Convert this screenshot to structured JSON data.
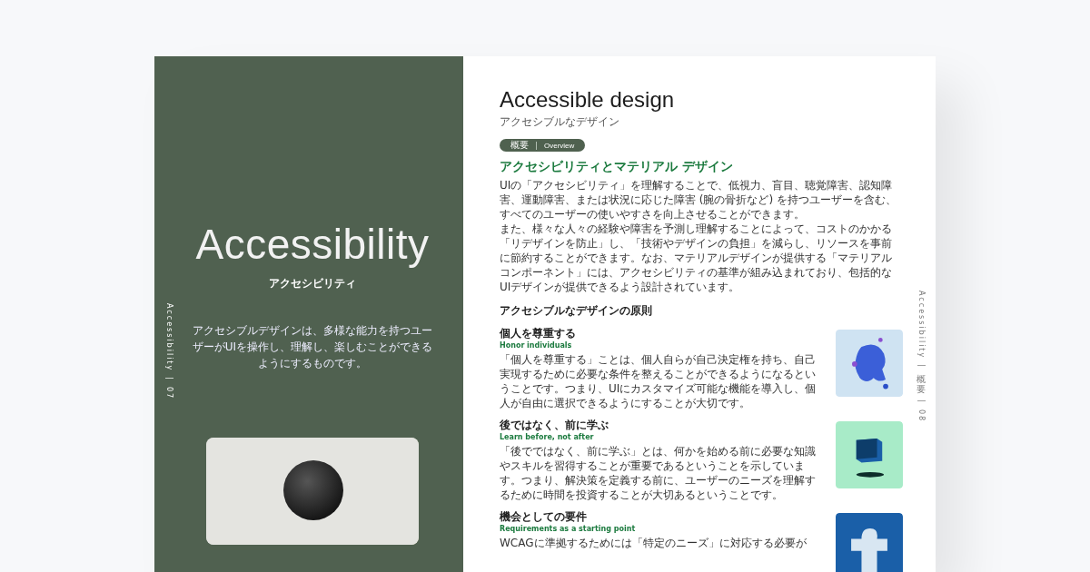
{
  "left_page": {
    "title": "Accessibility",
    "subtitle": "アクセシビリティ",
    "description": "アクセシブルデザインは、多様な能力を持つユーザーがUIを操作し、理解し、楽しむことができるようにするものです。",
    "side_label": [
      "Accessibility",
      "|",
      "07"
    ]
  },
  "right_page": {
    "title": "Accessible design",
    "subtitle": "アクセシブルなデザイン",
    "chip": [
      "概要",
      "Overview"
    ],
    "heading": "アクセシビリティとマテリアル デザイン",
    "paragraphs": [
      "UIの「アクセシビリティ」を理解することで、低視力、盲目、聴覚障害、認知障害、運動障害、または状況に応じた障害 (腕の骨折など) を持つユーザーを含む、すべてのユーザーの使いやすさを向上させることができます。",
      "また、様々な人々の経験や障害を予測し理解することによって、コストのかかる「リデザインを防止」し、「技術やデザインの負担」を減らし、リソースを事前に節約することができます。なお、マテリアルデザインが提供する「マテリアルコンポーネント」には、アクセシビリティの基準が組み込まれており、包括的なUIデザインが提供できるよう設計されています。"
    ],
    "principles_heading": "アクセシブルなデザインの原則",
    "principles": [
      {
        "kind": "head",
        "title": "個人を尊重する",
        "english": "Honor individuals",
        "body": "「個人を尊重する」ことは、個人自らが自己決定権を持ち、自己実現するために必要な条件を整えることができるようになるということです。つまり、UIにカスタマイズ可能な機能を導入し、個人が自由に選択できるようにすることが大切です。"
      },
      {
        "kind": "cube",
        "title": "後ではなく、前に学ぶ",
        "english": "Learn before, not after",
        "body": "「後でではなく、前に学ぶ」とは、何かを始める前に必要な知識やスキルを習得することが重要であるということを示しています。つまり、解決策を定義する前に、ユーザーのニーズを理解するために時間を投資することが大切あるということです。"
      },
      {
        "kind": "puzzle",
        "title": "機会としての要件",
        "english": "Requirements as a starting point",
        "body": "WCAGに準拠するためには「特定のニーズ」に対応する必要が"
      }
    ],
    "side_label": [
      "Accessibility",
      "|",
      "概要",
      "|",
      "08"
    ]
  }
}
